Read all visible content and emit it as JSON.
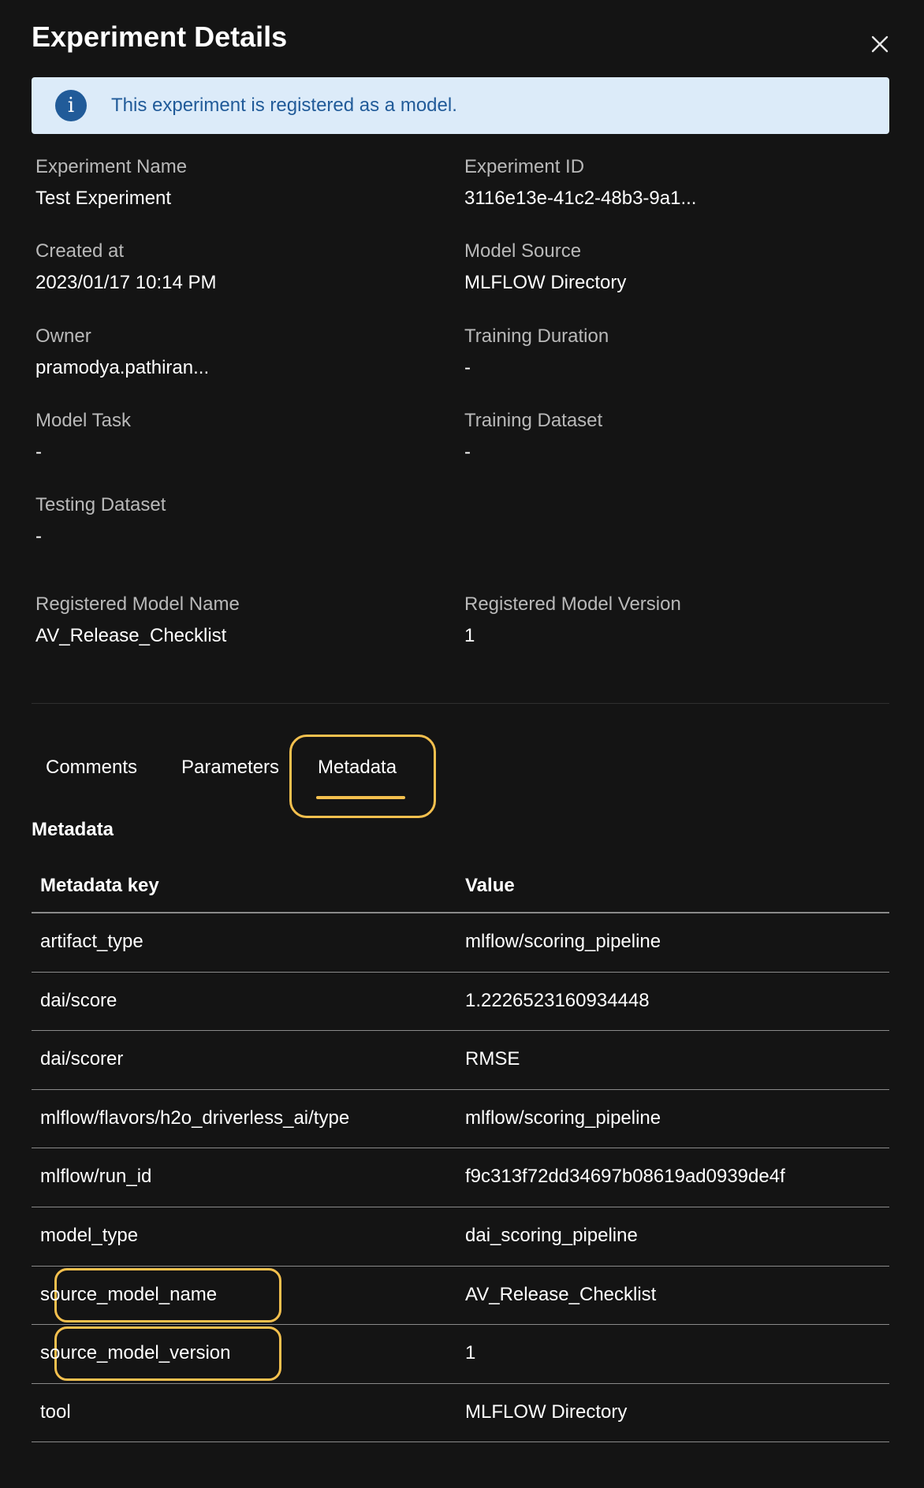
{
  "dialog": {
    "title": "Experiment Details",
    "info_banner": "This experiment is registered as a model.",
    "info_icon_glyph": "i"
  },
  "fields": {
    "experiment_name": {
      "label": "Experiment Name",
      "value": "Test Experiment"
    },
    "experiment_id": {
      "label": "Experiment ID",
      "value": "3116e13e-41c2-48b3-9a1..."
    },
    "created_at": {
      "label": "Created at",
      "value": "2023/01/17 10:14 PM"
    },
    "model_source": {
      "label": "Model Source",
      "value": "MLFLOW Directory"
    },
    "owner": {
      "label": "Owner",
      "value": "pramodya.pathiran..."
    },
    "training_duration": {
      "label": "Training Duration",
      "value": "-"
    },
    "model_task": {
      "label": "Model Task",
      "value": "-"
    },
    "training_dataset": {
      "label": "Training Dataset",
      "value": "-"
    },
    "testing_dataset": {
      "label": "Testing Dataset",
      "value": "-"
    },
    "registered_model_name": {
      "label": "Registered Model Name",
      "value": "AV_Release_Checklist"
    },
    "registered_model_version": {
      "label": "Registered Model Version",
      "value": "1"
    }
  },
  "tabs": [
    {
      "label": "Comments",
      "active": false
    },
    {
      "label": "Parameters",
      "active": false
    },
    {
      "label": "Metadata",
      "active": true
    }
  ],
  "metadata": {
    "section_title": "Metadata",
    "columns": [
      "Metadata key",
      "Value"
    ],
    "rows": [
      {
        "key": "artifact_type",
        "value": "mlflow/scoring_pipeline"
      },
      {
        "key": "dai/score",
        "value": "1.2226523160934448"
      },
      {
        "key": "dai/scorer",
        "value": "RMSE"
      },
      {
        "key": "mlflow/flavors/h2o_driverless_ai/type",
        "value": "mlflow/scoring_pipeline"
      },
      {
        "key": "mlflow/run_id",
        "value": "f9c313f72dd34697b08619ad0939de4f"
      },
      {
        "key": "model_type",
        "value": "dai_scoring_pipeline"
      },
      {
        "key": "source_model_name",
        "value": "AV_Release_Checklist"
      },
      {
        "key": "source_model_version",
        "value": "1"
      },
      {
        "key": "tool",
        "value": "MLFLOW Directory"
      }
    ]
  },
  "colors": {
    "background": "#141414",
    "banner_background": "#dcebf9",
    "banner_text": "#215b99",
    "highlight": "#f4c04e",
    "label_gray": "#b9b9b9"
  },
  "icons": {
    "close": "close-icon",
    "info": "info-icon"
  }
}
